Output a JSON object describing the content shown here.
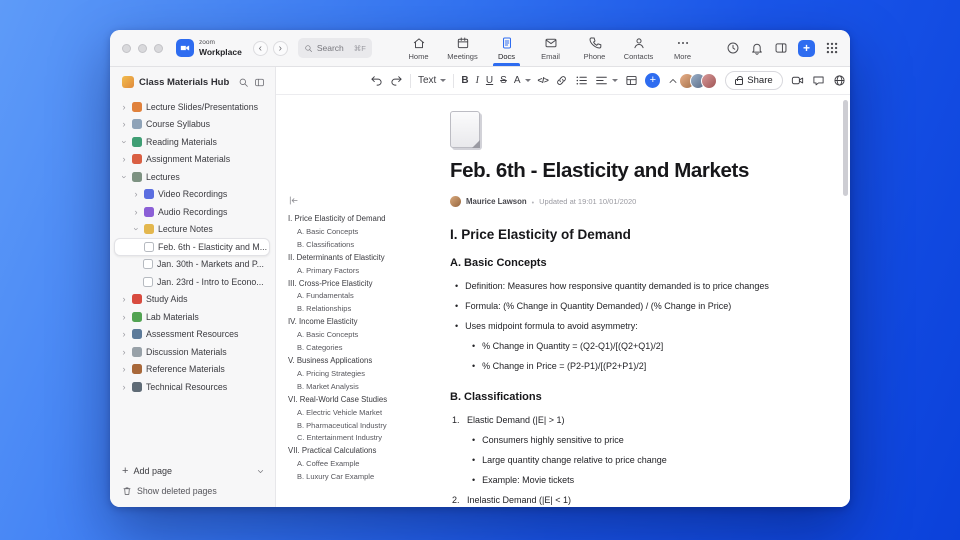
{
  "accent_color": "#2e6cf0",
  "chrome": {
    "logo": {
      "line1": "zoom",
      "line2": "Workplace"
    },
    "search": {
      "placeholder": "Search",
      "shortcut": "⌘F"
    },
    "tabs": [
      {
        "label": "Home",
        "icon": "home-icon",
        "active": false
      },
      {
        "label": "Meetings",
        "icon": "meetings-icon",
        "active": false
      },
      {
        "label": "Docs",
        "icon": "docs-icon",
        "active": true
      },
      {
        "label": "Email",
        "icon": "email-icon",
        "active": false
      },
      {
        "label": "Phone",
        "icon": "phone-icon",
        "active": false
      },
      {
        "label": "Contacts",
        "icon": "contacts-icon",
        "active": false
      },
      {
        "label": "More",
        "icon": "more-icon",
        "active": false
      }
    ],
    "right_icons": [
      "history-icon",
      "notifications-icon",
      "panel-icon",
      "new-button",
      "apps-grid-icon"
    ]
  },
  "sidebar": {
    "title": "Class Materials Hub",
    "items": [
      {
        "label": "Lecture Slides/Presentations",
        "icon": "presentation-icon",
        "level": 0,
        "expanded": false,
        "selected": false
      },
      {
        "label": "Course Syllabus",
        "icon": "syllabus-icon",
        "level": 0,
        "expanded": false,
        "selected": false
      },
      {
        "label": "Reading Materials",
        "icon": "book-icon",
        "level": 0,
        "expanded": true,
        "selected": false
      },
      {
        "label": "Assignment Materials",
        "icon": "assignment-icon",
        "level": 0,
        "expanded": false,
        "selected": false
      },
      {
        "label": "Lectures",
        "icon": "lectures-icon",
        "level": 0,
        "expanded": true,
        "selected": false
      },
      {
        "label": "Video Recordings",
        "icon": "video-icon",
        "level": 1,
        "expanded": false,
        "selected": false
      },
      {
        "label": "Audio Recordings",
        "icon": "audio-icon",
        "level": 1,
        "expanded": false,
        "selected": false
      },
      {
        "label": "Lecture Notes",
        "icon": "notes-icon",
        "level": 1,
        "expanded": true,
        "selected": false
      },
      {
        "label": "Feb. 6th - Elasticity and M...",
        "icon": "document-icon",
        "level": 2,
        "expanded": false,
        "selected": true
      },
      {
        "label": "Jan. 30th - Markets and P...",
        "icon": "document-icon",
        "level": 2,
        "expanded": false,
        "selected": false
      },
      {
        "label": "Jan. 23rd - Intro to Econo...",
        "icon": "document-icon",
        "level": 2,
        "expanded": false,
        "selected": false
      },
      {
        "label": "Study Aids",
        "icon": "study-icon",
        "level": 0,
        "expanded": false,
        "selected": false
      },
      {
        "label": "Lab Materials",
        "icon": "lab-icon",
        "level": 0,
        "expanded": false,
        "selected": false
      },
      {
        "label": "Assessment Resources",
        "icon": "assessment-icon",
        "level": 0,
        "expanded": false,
        "selected": false
      },
      {
        "label": "Discussion Materials",
        "icon": "discussion-icon",
        "level": 0,
        "expanded": false,
        "selected": false
      },
      {
        "label": "Reference Materials",
        "icon": "reference-icon",
        "level": 0,
        "expanded": false,
        "selected": false
      },
      {
        "label": "Technical Resources",
        "icon": "technical-icon",
        "level": 0,
        "expanded": false,
        "selected": false
      }
    ],
    "add_page_label": "Add page",
    "show_deleted_label": "Show deleted pages"
  },
  "toolbar": {
    "text_style_label": "Text",
    "bold_label": "B",
    "italic_label": "I",
    "underline_label": "U",
    "strike_label": "S",
    "color_label": "A",
    "code_label": "</>",
    "share_label": "Share",
    "avatar_count": 3,
    "right_icons": [
      "video-camera-icon",
      "chat-icon",
      "globe-icon",
      "more-icon"
    ]
  },
  "doc": {
    "title": "Feb. 6th - Elasticity and Markets",
    "author": "Maurice Lawson",
    "updated": "Updated at 19:01 10/01/2020",
    "outline": [
      {
        "label": "I. Price Elasticity of Demand",
        "level": 0
      },
      {
        "label": "A. Basic Concepts",
        "level": 1
      },
      {
        "label": "B. Classifications",
        "level": 1
      },
      {
        "label": "II. Determinants of Elasticity",
        "level": 0
      },
      {
        "label": "A. Primary Factors",
        "level": 1
      },
      {
        "label": "III. Cross-Price Elasticity",
        "level": 0
      },
      {
        "label": "A. Fundamentals",
        "level": 1
      },
      {
        "label": "B. Relationships",
        "level": 1
      },
      {
        "label": "IV. Income Elasticity",
        "level": 0
      },
      {
        "label": "A. Basic Concepts",
        "level": 1
      },
      {
        "label": "B. Categories",
        "level": 1
      },
      {
        "label": "V. Business Applications",
        "level": 0
      },
      {
        "label": "A. Pricing Strategies",
        "level": 1
      },
      {
        "label": "B. Market Analysis",
        "level": 1
      },
      {
        "label": "VI. Real-World Case Studies",
        "level": 0
      },
      {
        "label": "A. Electric Vehicle Market",
        "level": 1
      },
      {
        "label": "B. Pharmaceutical Industry",
        "level": 1
      },
      {
        "label": "C. Entertainment Industry",
        "level": 1
      },
      {
        "label": "VII. Practical Calculations",
        "level": 0
      },
      {
        "label": "A. Coffee Example",
        "level": 1
      },
      {
        "label": "B. Luxury Car Example",
        "level": 1
      }
    ],
    "content": {
      "h1": "I. Price Elasticity of Demand",
      "section_a": {
        "title": "A. Basic Concepts",
        "bullets": [
          "Definition: Measures how responsive quantity demanded is to price changes",
          "Formula: (% Change in Quantity Demanded) / (% Change in Price)",
          "Uses midpoint formula to avoid asymmetry:"
        ],
        "subbullets": [
          "% Change in Quantity = (Q2-Q1)/[(Q2+Q1)/2]",
          "% Change in Price = (P2-P1)/[(P2+P1)/2]"
        ]
      },
      "section_b": {
        "title": "B. Classifications",
        "items": [
          {
            "num": "1.",
            "text": "Elastic Demand (|E| > 1)",
            "subbullets": [
              "Consumers highly sensitive to price",
              "Large quantity change relative to price change",
              "Example: Movie tickets"
            ]
          },
          {
            "num": "2.",
            "text": "Inelastic Demand (|E| < 1)",
            "subbullets": []
          }
        ]
      }
    }
  }
}
